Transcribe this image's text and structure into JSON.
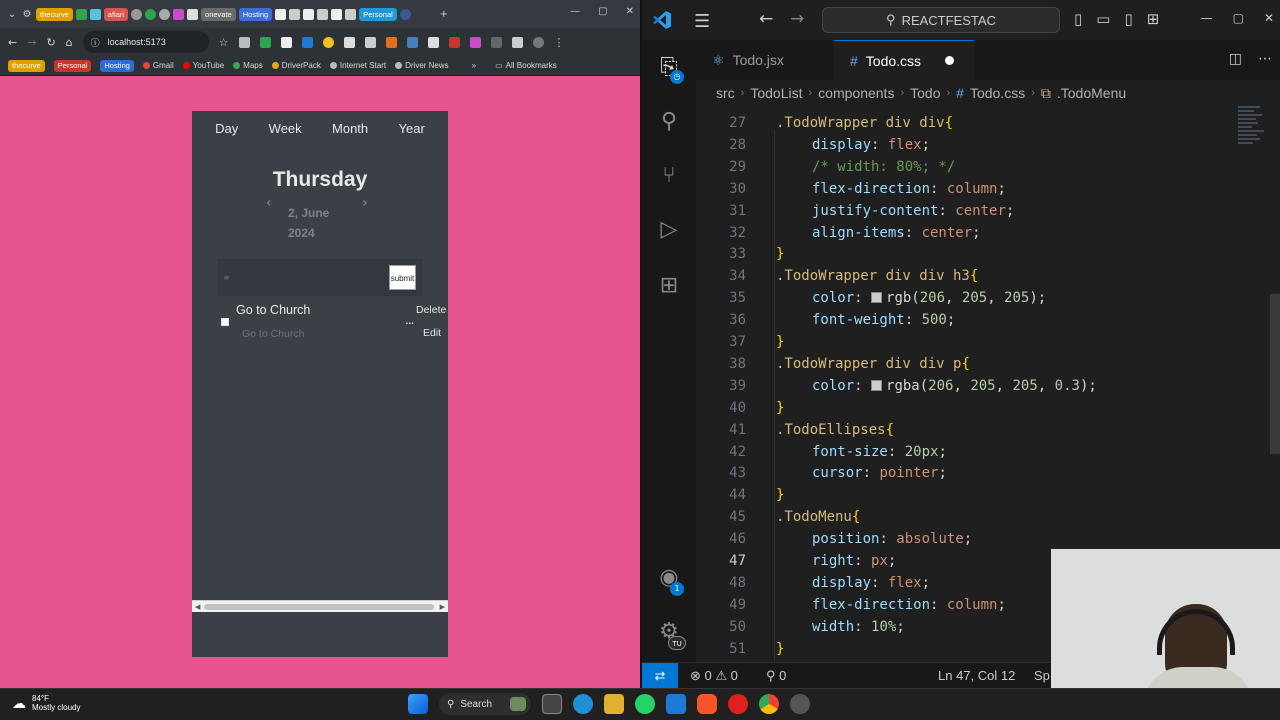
{
  "browser": {
    "tabs": [
      {
        "label": "thecurve",
        "color": "#e0a100"
      },
      {
        "label": "afiari",
        "color": "#d9534f"
      },
      {
        "label": "onevate",
        "color": "#6b6b6b"
      },
      {
        "label": "Hosting",
        "color": "#3b6fd8"
      },
      {
        "label": "Personal",
        "color": "#1f9ad6"
      }
    ],
    "new_tab": "+",
    "url": "localhost:5173",
    "bookmarks": {
      "chips": [
        {
          "label": "thecurve",
          "color": "#e0a100"
        },
        {
          "label": "Personal",
          "color": "#c0392b"
        },
        {
          "label": "Hosting",
          "color": "#2e6bd6"
        }
      ],
      "items": [
        "Gmail",
        "YouTube",
        "Maps",
        "DriverPack",
        "Internet Start",
        "Driver News"
      ],
      "more": "»",
      "all": "All Bookmarks"
    }
  },
  "todo_app": {
    "periods": [
      "Day",
      "Week",
      "Month",
      "Year"
    ],
    "day_name": "Thursday",
    "date_line1": "2, June",
    "date_line2": "2024",
    "prev_arrow": "‹",
    "next_arrow": "›",
    "input_placeholder": "≡",
    "submit_label": "submit",
    "todo": {
      "title": "Go to Church",
      "subtitle": "Go to Church",
      "menu_icon": "...",
      "delete_label": "Delete",
      "edit_label": "Edit"
    }
  },
  "vscode": {
    "search_text": "REACTFESTAC",
    "tabs": [
      {
        "label": "Todo.jsx",
        "icon": "react-icon"
      },
      {
        "label": "Todo.css",
        "icon": "css-icon",
        "active": true,
        "modified": true
      }
    ],
    "breadcrumb": [
      "src",
      "TodoList",
      "components",
      "Todo",
      "Todo.css",
      ".TodoMenu"
    ],
    "activity_badges": {
      "accounts": "1",
      "settings": "TU"
    },
    "lines": [
      {
        "n": "27",
        "text": ".TodoWrapper div div{"
      },
      {
        "n": "28",
        "text": "display: flex;"
      },
      {
        "n": "29",
        "text": "/* width: 80%; */"
      },
      {
        "n": "30",
        "text": "flex-direction: column;"
      },
      {
        "n": "31",
        "text": "justify-content: center;"
      },
      {
        "n": "32",
        "text": "align-items: center;"
      },
      {
        "n": "33",
        "text": "}"
      },
      {
        "n": "34",
        "text": ".TodoWrapper div div h3{"
      },
      {
        "n": "35",
        "text": "color: rgb(206, 205, 205);"
      },
      {
        "n": "36",
        "text": "font-weight: 500;"
      },
      {
        "n": "37",
        "text": "}"
      },
      {
        "n": "38",
        "text": ".TodoWrapper div div p{"
      },
      {
        "n": "39",
        "text": "color: rgba(206, 205, 205, 0.3);"
      },
      {
        "n": "40",
        "text": "}"
      },
      {
        "n": "41",
        "text": ".TodoEllipses{"
      },
      {
        "n": "42",
        "text": "font-size: 20px;"
      },
      {
        "n": "43",
        "text": "cursor: pointer;"
      },
      {
        "n": "44",
        "text": "}"
      },
      {
        "n": "45",
        "text": ".TodoMenu{"
      },
      {
        "n": "46",
        "text": "position: absolute;"
      },
      {
        "n": "47",
        "text": "right: px;"
      },
      {
        "n": "48",
        "text": "display: flex;"
      },
      {
        "n": "49",
        "text": "flex-direction: column;"
      },
      {
        "n": "50",
        "text": "width: 10%;"
      },
      {
        "n": "51",
        "text": "}"
      }
    ],
    "status": {
      "errors": "⊗ 0 ⚠ 0",
      "ports": "⚲ 0",
      "cursor": "Ln 47, Col 12",
      "spaces": "Sp"
    }
  },
  "taskbar": {
    "temperature": "84°F",
    "weather": "Mostly cloudy",
    "search": "Search"
  }
}
